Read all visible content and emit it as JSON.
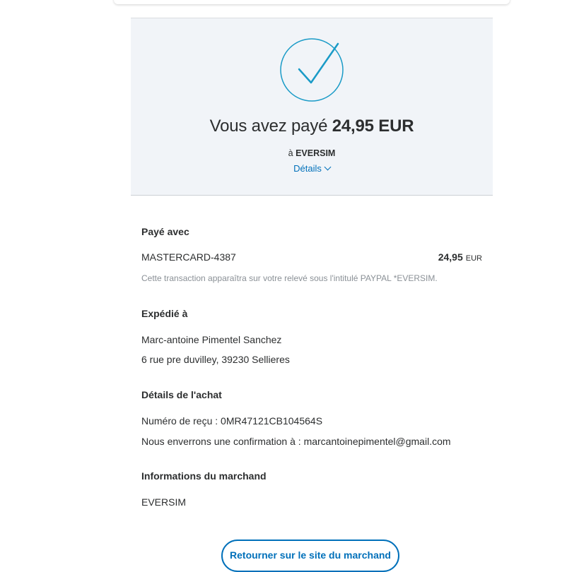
{
  "hero": {
    "title_prefix": "Vous avez payé",
    "amount": "24,95 EUR",
    "merchant_prefix": "à",
    "merchant": "EVERSIM",
    "details_label": "Détails"
  },
  "paid_with": {
    "title": "Payé avec",
    "card": "MASTERCARD-4387",
    "amount": "24,95",
    "currency": "EUR",
    "note": "Cette transaction apparaîtra sur votre relevé sous l'intitulé PAYPAL *EVERSIM."
  },
  "shipped_to": {
    "title": "Expédié à",
    "name": "Marc-antoine Pimentel Sanchez",
    "address": "6 rue pre duvilley, 39230 Sellieres"
  },
  "purchase_details": {
    "title": "Détails de l'achat",
    "receipt": "Numéro de reçu : 0MR47121CB104564S",
    "confirmation": "Nous enverrons une confirmation à : marcantoinepimentel@gmail.com"
  },
  "merchant_info": {
    "title": "Informations du marchand",
    "name": "EVERSIM"
  },
  "actions": {
    "return_label": "Retourner sur le site du marchand"
  },
  "colors": {
    "accent": "#0070ba",
    "check": "#1a9bc7",
    "hero_bg": "#f1f4f8"
  },
  "icons": {
    "success": "check-circle-icon",
    "details": "chevron-down-icon"
  }
}
